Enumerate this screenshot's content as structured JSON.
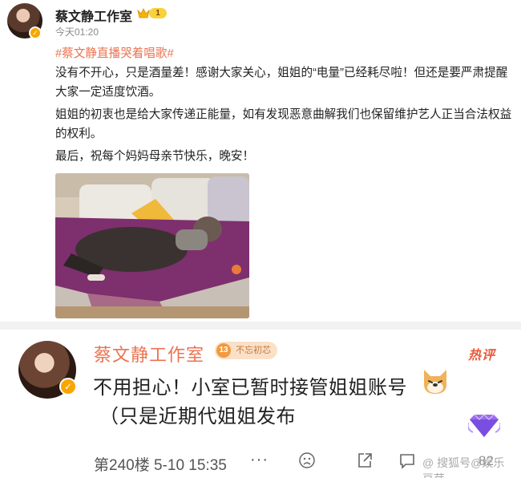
{
  "post": {
    "author": "蔡文静工作室",
    "vip_level": "1",
    "time": "今天01:20",
    "hashtag": "#蔡文静直播哭着唱歌#",
    "paragraph1": "没有不开心，只是酒量差！感谢大家关心，姐姐的“电量”已经耗尽啦！但还是要严肃提醒大家一定适度饮酒。",
    "paragraph2": "姐姐的初衷也是给大家传递正能量，如有发现恶意曲解我们也保留维护艺人正当合法权益的权利。",
    "paragraph3": "最后，祝每个妈妈母亲节快乐，晚安！"
  },
  "comment": {
    "author": "蔡文静工作室",
    "tag_number": "13",
    "tag_text": "不忘初芯",
    "hot_label": "热评",
    "line1": "不用担心！小室已暂时接管姐姐账号",
    "line2": "（只是近期代姐姐发布",
    "floor": "第240楼",
    "date": "5-10 15:35",
    "more": "···",
    "repost_count": "82",
    "watermark": "@ 搜狐号@娱乐豆芽"
  },
  "colors": {
    "accent": "#eb7350",
    "verify": "#f7a600",
    "divider": "#f2f2f2"
  },
  "icons": [
    "crown-icon",
    "verify-icon",
    "dog-emoji-icon",
    "gem-icon",
    "sad-face-icon",
    "repost-icon",
    "comment-icon",
    "like-icon"
  ]
}
